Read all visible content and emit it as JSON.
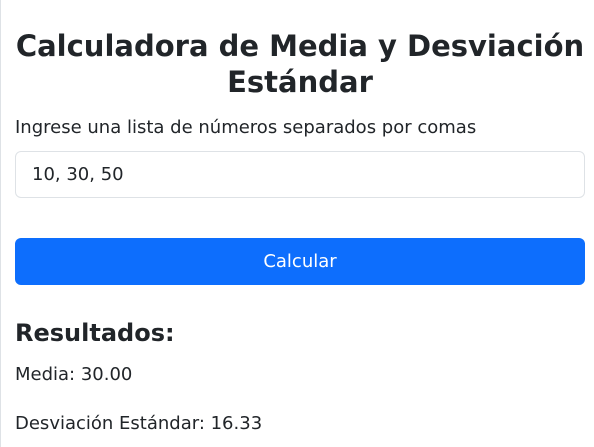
{
  "page": {
    "title": "Calculadora de Media y Desviación Estándar"
  },
  "form": {
    "label": "Ingrese una lista de números separados por comas",
    "input_value": "10, 30, 50",
    "button_label": "Calcular"
  },
  "results": {
    "heading": "Resultados:",
    "mean_text": "Media: 30.00",
    "std_text": "Desviación Estándar: 16.33"
  },
  "colors": {
    "primary": "#0d6efd",
    "text": "#212529",
    "border": "#dee2e6"
  }
}
